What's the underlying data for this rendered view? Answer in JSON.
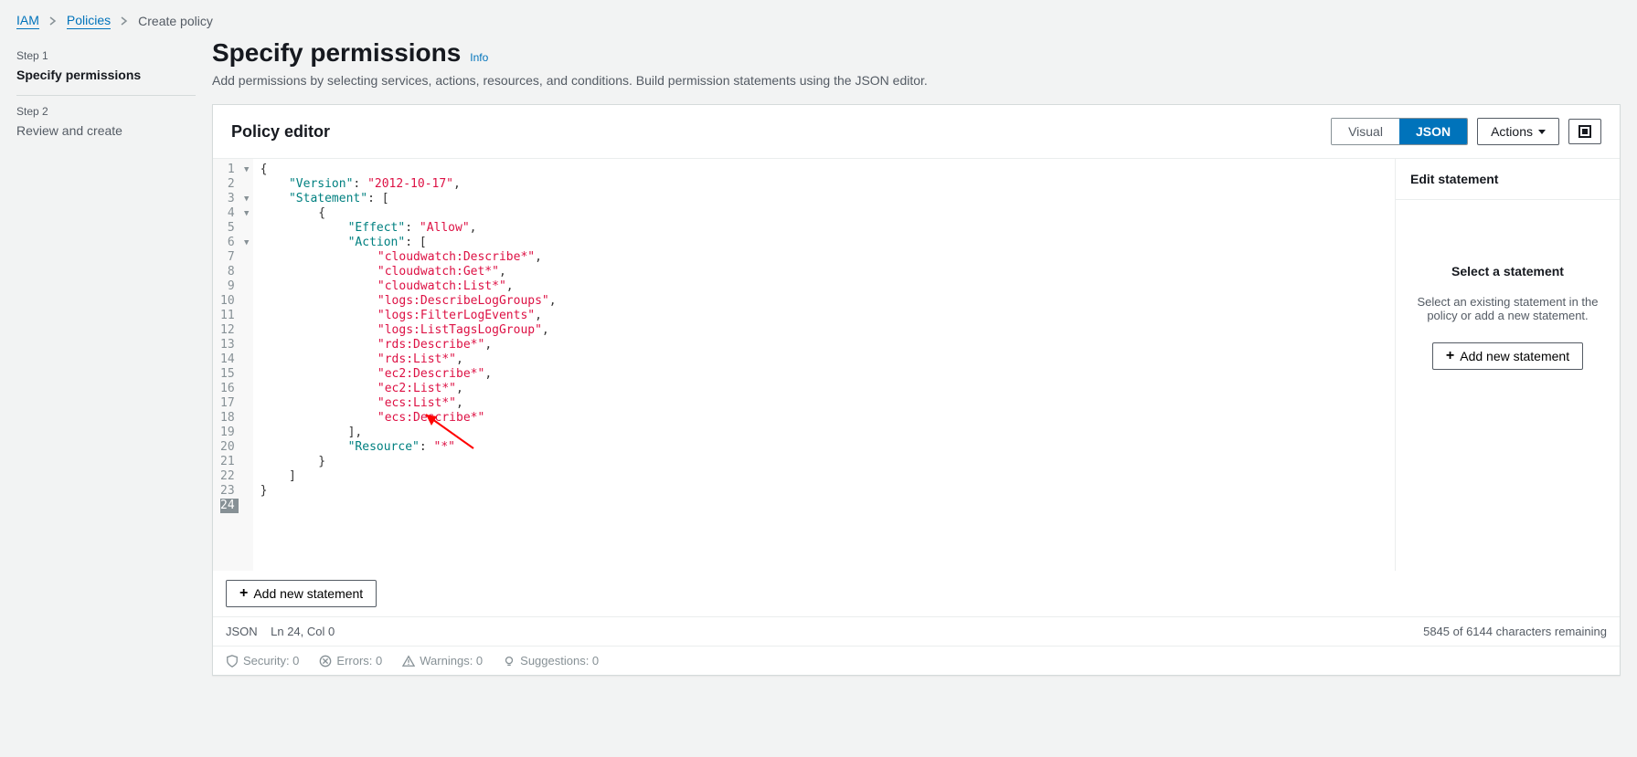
{
  "breadcrumb": {
    "items": [
      "IAM",
      "Policies",
      "Create policy"
    ]
  },
  "steps": {
    "step1_label": "Step 1",
    "step1_name": "Specify permissions",
    "step2_label": "Step 2",
    "step2_name": "Review and create"
  },
  "header": {
    "title": "Specify permissions",
    "info": "Info",
    "subtitle": "Add permissions by selecting services, actions, resources, and conditions. Build permission statements using the JSON editor."
  },
  "panel": {
    "title": "Policy editor",
    "tab_visual": "Visual",
    "tab_json": "JSON",
    "actions": "Actions",
    "add_statement": "Add new statement"
  },
  "code_lines": [
    {
      "n": 1,
      "fold": true,
      "tokens": [
        {
          "t": "{",
          "c": "punc"
        }
      ]
    },
    {
      "n": 2,
      "fold": false,
      "indent": "    ",
      "tokens": [
        {
          "t": "\"Version\"",
          "c": "key"
        },
        {
          "t": ": ",
          "c": "punc"
        },
        {
          "t": "\"2012-10-17\"",
          "c": "str"
        },
        {
          "t": ",",
          "c": "punc"
        }
      ]
    },
    {
      "n": 3,
      "fold": true,
      "indent": "    ",
      "tokens": [
        {
          "t": "\"Statement\"",
          "c": "key"
        },
        {
          "t": ": [",
          "c": "punc"
        }
      ]
    },
    {
      "n": 4,
      "fold": true,
      "indent": "        ",
      "tokens": [
        {
          "t": "{",
          "c": "punc"
        }
      ]
    },
    {
      "n": 5,
      "fold": false,
      "indent": "            ",
      "tokens": [
        {
          "t": "\"Effect\"",
          "c": "key"
        },
        {
          "t": ": ",
          "c": "punc"
        },
        {
          "t": "\"Allow\"",
          "c": "str"
        },
        {
          "t": ",",
          "c": "punc"
        }
      ]
    },
    {
      "n": 6,
      "fold": true,
      "indent": "            ",
      "tokens": [
        {
          "t": "\"Action\"",
          "c": "key"
        },
        {
          "t": ": [",
          "c": "punc"
        }
      ]
    },
    {
      "n": 7,
      "fold": false,
      "indent": "                ",
      "tokens": [
        {
          "t": "\"cloudwatch:Describe*\"",
          "c": "str"
        },
        {
          "t": ",",
          "c": "punc"
        }
      ]
    },
    {
      "n": 8,
      "fold": false,
      "indent": "                ",
      "tokens": [
        {
          "t": "\"cloudwatch:Get*\"",
          "c": "str"
        },
        {
          "t": ",",
          "c": "punc"
        }
      ]
    },
    {
      "n": 9,
      "fold": false,
      "indent": "                ",
      "tokens": [
        {
          "t": "\"cloudwatch:List*\"",
          "c": "str"
        },
        {
          "t": ",",
          "c": "punc"
        }
      ]
    },
    {
      "n": 10,
      "fold": false,
      "indent": "                ",
      "tokens": [
        {
          "t": "\"logs:DescribeLogGroups\"",
          "c": "str"
        },
        {
          "t": ",",
          "c": "punc"
        }
      ]
    },
    {
      "n": 11,
      "fold": false,
      "indent": "                ",
      "tokens": [
        {
          "t": "\"logs:FilterLogEvents\"",
          "c": "str"
        },
        {
          "t": ",",
          "c": "punc"
        }
      ]
    },
    {
      "n": 12,
      "fold": false,
      "indent": "                ",
      "tokens": [
        {
          "t": "\"logs:ListTagsLogGroup\"",
          "c": "str"
        },
        {
          "t": ",",
          "c": "punc"
        }
      ]
    },
    {
      "n": 13,
      "fold": false,
      "indent": "                ",
      "tokens": [
        {
          "t": "\"rds:Describe*\"",
          "c": "str"
        },
        {
          "t": ",",
          "c": "punc"
        }
      ]
    },
    {
      "n": 14,
      "fold": false,
      "indent": "                ",
      "tokens": [
        {
          "t": "\"rds:List*\"",
          "c": "str"
        },
        {
          "t": ",",
          "c": "punc"
        }
      ]
    },
    {
      "n": 15,
      "fold": false,
      "indent": "                ",
      "tokens": [
        {
          "t": "\"ec2:Describe*\"",
          "c": "str"
        },
        {
          "t": ",",
          "c": "punc"
        }
      ]
    },
    {
      "n": 16,
      "fold": false,
      "indent": "                ",
      "tokens": [
        {
          "t": "\"ec2:List*\"",
          "c": "str"
        },
        {
          "t": ",",
          "c": "punc"
        }
      ]
    },
    {
      "n": 17,
      "fold": false,
      "indent": "                ",
      "tokens": [
        {
          "t": "\"ecs:List*\"",
          "c": "str"
        },
        {
          "t": ",",
          "c": "punc"
        }
      ]
    },
    {
      "n": 18,
      "fold": false,
      "indent": "                ",
      "tokens": [
        {
          "t": "\"ecs:Describe*\"",
          "c": "str"
        }
      ]
    },
    {
      "n": 19,
      "fold": false,
      "indent": "            ",
      "tokens": [
        {
          "t": "],",
          "c": "punc"
        }
      ]
    },
    {
      "n": 20,
      "fold": false,
      "indent": "            ",
      "tokens": [
        {
          "t": "\"Resource\"",
          "c": "key"
        },
        {
          "t": ": ",
          "c": "punc"
        },
        {
          "t": "\"*\"",
          "c": "str"
        }
      ]
    },
    {
      "n": 21,
      "fold": false,
      "indent": "        ",
      "tokens": [
        {
          "t": "}",
          "c": "punc"
        }
      ]
    },
    {
      "n": 22,
      "fold": false,
      "indent": "    ",
      "tokens": [
        {
          "t": "]",
          "c": "punc"
        }
      ]
    },
    {
      "n": 23,
      "fold": false,
      "tokens": [
        {
          "t": "}",
          "c": "punc"
        }
      ]
    },
    {
      "n": 24,
      "fold": false,
      "tokens": []
    }
  ],
  "sidepanel": {
    "title": "Edit statement",
    "empty_title": "Select a statement",
    "empty_text": "Select an existing statement in the policy or add a new statement.",
    "add_btn": "Add new statement"
  },
  "status": {
    "mode": "JSON",
    "cursor": "Ln 24, Col 0",
    "remaining": "5845 of 6144 characters remaining",
    "security": "Security: 0",
    "errors": "Errors: 0",
    "warnings": "Warnings: 0",
    "suggestions": "Suggestions: 0"
  }
}
